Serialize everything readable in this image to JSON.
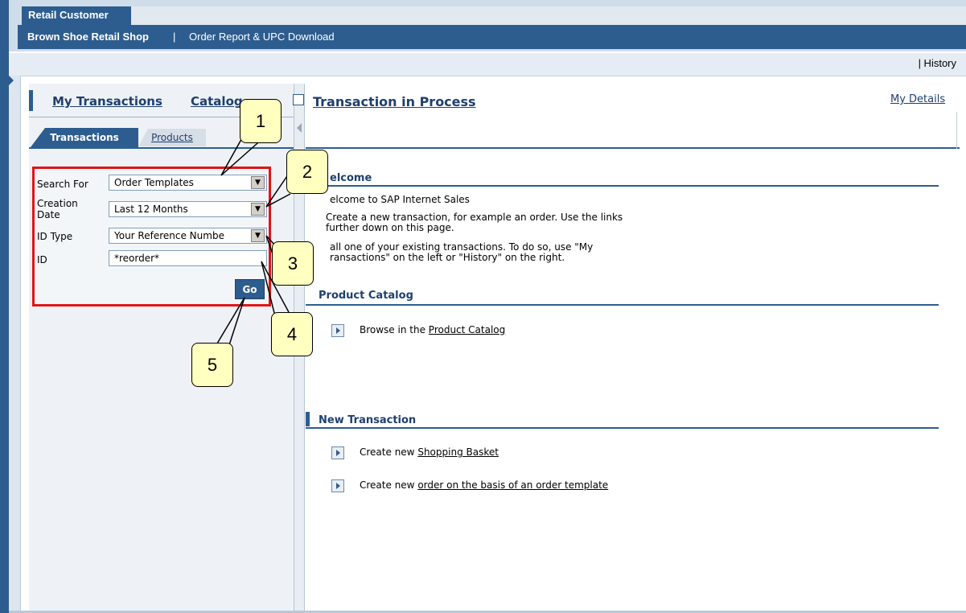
{
  "header": {
    "tab_label": "Retail Customer",
    "shop_name": "Brown Shoe Retail Shop",
    "separator": "|",
    "report_link": "Order Report & UPC Download"
  },
  "history": {
    "label": "| History"
  },
  "left": {
    "my_transactions": "My Transactions",
    "catalog": "Catalog",
    "tabs": {
      "transactions": "Transactions",
      "products": "Products"
    },
    "form": {
      "search_for_label": "Search For",
      "search_for_value": "Order Templates",
      "creation_label_1": "Creation",
      "creation_label_2": "Date",
      "creation_value": "Last 12 Months",
      "id_type_label": "ID Type",
      "id_type_value": "Your Reference Numbe",
      "id_label": "ID",
      "id_value": "*reorder*",
      "go_label": "Go"
    }
  },
  "right": {
    "title": "Transaction in Process",
    "my_details": "My Details",
    "welcome": {
      "title": "elcome",
      "line1": "elcome to SAP Internet Sales",
      "line2a": "Create a new transaction, for example an order. Use the links",
      "line2b": "further down on this page.",
      "line3a": "all one of your existing transactions. To do so, use \"My",
      "line3b": "ransactions\" on the left or \"History\" on the right."
    },
    "catalog_section": {
      "title": "Product Catalog",
      "browse_prefix": "Browse in the",
      "browse_link": "Product Catalog"
    },
    "new_transaction": {
      "title": "New Transaction",
      "item1_prefix": "Create new",
      "item1_link": "Shopping Basket",
      "item2_prefix": "Create new",
      "item2_link": "order on the basis of an order template"
    }
  },
  "callouts": [
    "1",
    "2",
    "3",
    "4",
    "5"
  ],
  "colors": {
    "brand_blue": "#2d5d8f",
    "callout_fill": "#ffffc0",
    "highlight_red": "#e01515"
  }
}
